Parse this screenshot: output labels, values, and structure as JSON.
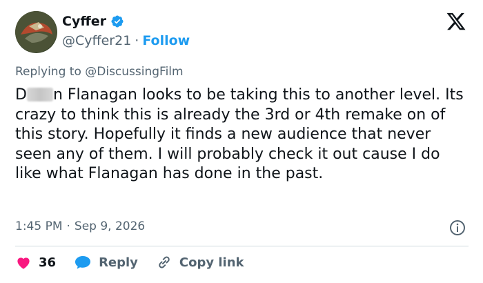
{
  "header": {
    "display_name": "Cyffer",
    "handle": "@Cyffer21",
    "separator": "·",
    "follow_label": "Follow",
    "verified_color": "#1d9bf0"
  },
  "reply": {
    "prefix": "Replying to ",
    "mention": "@DiscussingFilm"
  },
  "tweet": {
    "text_start": "D",
    "text_rest": "n Flanagan looks to be taking this to another level. Its crazy to think this is already the 3rd or 4th remake on of this story. Hopefully it finds a new audience that never seen any of them. I will probably check it out cause I do like what Flanagan has done in the past."
  },
  "meta": {
    "time": "1:45 PM",
    "separator": "·",
    "date": "Sep 9, 2026"
  },
  "actions": {
    "like_count": "36",
    "reply_label": "Reply",
    "copy_link_label": "Copy link",
    "like_color": "#f91880",
    "reply_color": "#1d9bf0"
  },
  "icons": [
    "verified-badge-icon",
    "x-logo-icon",
    "info-icon",
    "heart-icon",
    "reply-bubble-icon",
    "link-icon"
  ]
}
